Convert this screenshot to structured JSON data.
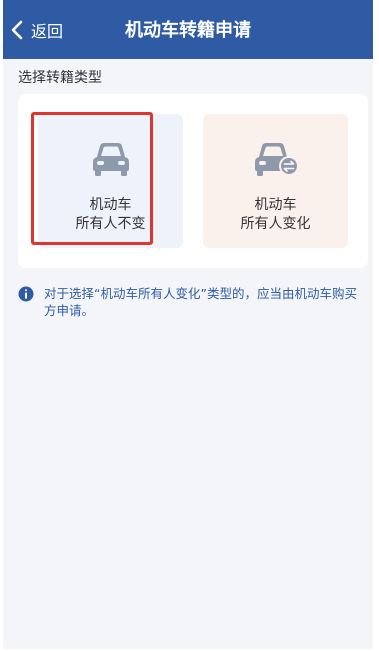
{
  "header": {
    "back_label": "返回",
    "title": "机动车转籍申请"
  },
  "section_label": "选择转籍类型",
  "options": [
    {
      "line1": "机动车",
      "line2": "所有人不变",
      "icon": "car-icon",
      "selected": true
    },
    {
      "line1": "机动车",
      "line2": "所有人变化",
      "icon": "car-transfer-icon",
      "selected": false
    }
  ],
  "notice": {
    "icon": "info-icon",
    "text": "对于选择“机动车所有人变化”类型的，应当由机动车购买方申请。"
  },
  "colors": {
    "header_bg": "#2f5ba5",
    "page_bg": "#f4f5f9",
    "selected_outline": "#e0342e",
    "option_left_bg": "#eef3fb",
    "option_right_bg": "#fbf1ec",
    "icon_gray": "#8e99ac",
    "notice_text": "#2f5ba5"
  }
}
